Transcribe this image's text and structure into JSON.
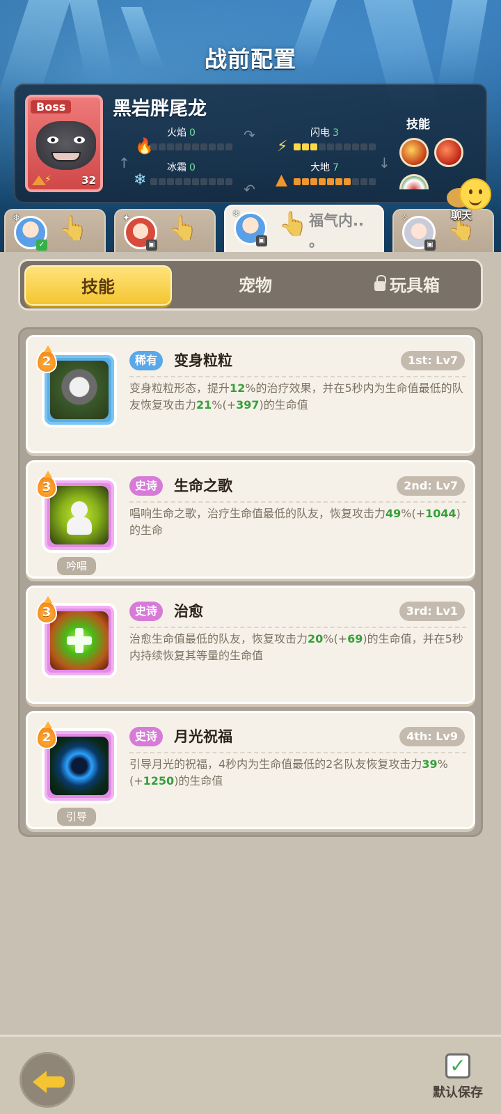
{
  "header": {
    "title": "战前配置"
  },
  "boss": {
    "tag": "Boss",
    "name": "黑岩胖尾龙",
    "level": "32",
    "skills_label": "技能",
    "elements": {
      "fire": {
        "label": "火焰",
        "value": "0"
      },
      "lightning": {
        "label": "闪电",
        "value": "3"
      },
      "frost": {
        "label": "冰霜",
        "value": "0"
      },
      "earth": {
        "label": "大地",
        "value": "7"
      }
    },
    "skill_icons": [
      "fire-vortex-icon",
      "fire-swirl-icon",
      "shield-icon"
    ]
  },
  "chat": {
    "label": "聊天"
  },
  "hero_tabs": [
    {
      "avatar": "blue-hair-hero",
      "badge": "green",
      "active": false
    },
    {
      "avatar": "red-hair-hero",
      "badge": "grey",
      "active": false
    },
    {
      "avatar": "blue-hair-hero",
      "badge": "grey",
      "active": true,
      "name": "福气内.. 。"
    },
    {
      "avatar": "silver-hair-hero",
      "badge": "grey",
      "active": false
    }
  ],
  "segments": {
    "skills": "技能",
    "pets": "宠物",
    "toybox": "玩具箱"
  },
  "skills": [
    {
      "cost": "2",
      "rarity": "稀有",
      "name": "变身粒粒",
      "slot": "1st: Lv7",
      "desc": [
        {
          "t": "变身粒粒形态，提升"
        },
        {
          "t": "12",
          "g": true
        },
        {
          "t": "%的治疗效果，并在5秒内为生命值最低的队友恢复攻击力"
        },
        {
          "t": "21",
          "g": true
        },
        {
          "t": "%(+"
        },
        {
          "t": "397",
          "g": true
        },
        {
          "t": ")的生命值"
        }
      ],
      "tag": ""
    },
    {
      "cost": "3",
      "rarity": "史诗",
      "name": "生命之歌",
      "slot": "2nd: Lv7",
      "desc": [
        {
          "t": "唱响生命之歌，治疗生命值最低的队友，恢复攻击力"
        },
        {
          "t": "49",
          "g": true
        },
        {
          "t": "%(+"
        },
        {
          "t": "1044",
          "g": true
        },
        {
          "t": ")的生命"
        }
      ],
      "tag": "吟唱"
    },
    {
      "cost": "3",
      "rarity": "史诗",
      "name": "治愈",
      "slot": "3rd: Lv1",
      "desc": [
        {
          "t": "治愈生命值最低的队友，恢复攻击力"
        },
        {
          "t": "20",
          "g": true
        },
        {
          "t": "%(+"
        },
        {
          "t": "69",
          "g": true
        },
        {
          "t": ")的生命值，并在5秒内持续恢复其等量的生命值"
        }
      ],
      "tag": ""
    },
    {
      "cost": "2",
      "rarity": "史诗",
      "name": "月光祝福",
      "slot": "4th: Lv9",
      "desc": [
        {
          "t": "引导月光的祝福，4秒内为生命值最低的2名队友恢复攻击力"
        },
        {
          "t": "39",
          "g": true
        },
        {
          "t": "%(+"
        },
        {
          "t": "1250",
          "g": true
        },
        {
          "t": ")的生命值"
        }
      ],
      "tag": "引导"
    }
  ],
  "footer": {
    "save_label": "默认保存",
    "save_checked": true
  },
  "colors": {
    "accent_yellow": "#f4c531",
    "rare_blue": "#5aa8e8",
    "epic_pink": "#d77ad8",
    "value_green": "#35a03a"
  }
}
